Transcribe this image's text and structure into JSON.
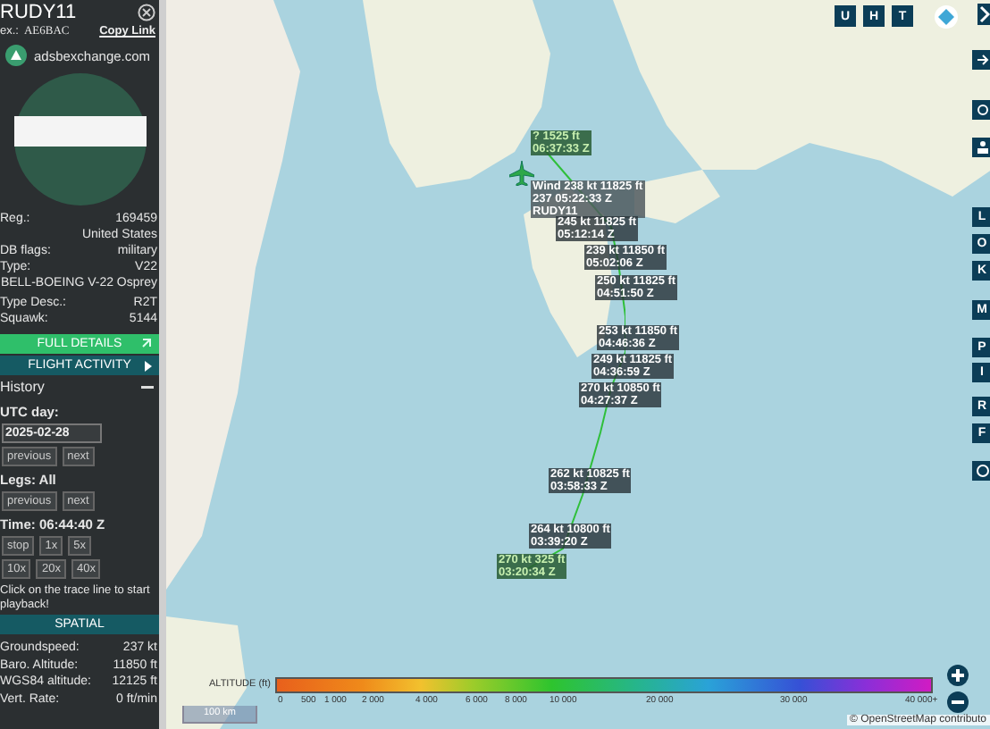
{
  "sidebar": {
    "title": "RUDY11",
    "hex_label": "ex.:",
    "hex": "AE6BAC",
    "copy_link": "Copy Link",
    "source": "adsbexchange.com",
    "details": [
      {
        "kind": "pair",
        "label": "Reg.:",
        "value": "169459"
      },
      {
        "kind": "value",
        "value": "United States"
      },
      {
        "kind": "pair",
        "label": "DB flags:",
        "value": "military"
      },
      {
        "kind": "pair",
        "label": "Type:",
        "value": "V22"
      },
      {
        "kind": "value",
        "value": "BELL-BOEING V-22 Osprey"
      },
      {
        "kind": "pair",
        "label": "Type Desc.:",
        "value": "R2T"
      },
      {
        "kind": "pair",
        "label": "Squawk:",
        "value": "5144"
      }
    ],
    "full_details": "FULL DETAILS",
    "flight_activity": {
      "label": "FLIGHT ACTIVITY",
      "expanded": false
    },
    "history": {
      "title": "History",
      "expanded": true,
      "utc_label": "UTC day:",
      "date": "2025-02-28",
      "day_buttons": [
        "previous",
        "next"
      ],
      "legs_label": "Legs: All",
      "leg_buttons": [
        "previous",
        "next"
      ],
      "time": "Time: 06:44:40 Z",
      "speed_buttons": [
        [
          "stop",
          "1x",
          "5x"
        ],
        [
          "10x",
          "20x",
          "40x"
        ]
      ],
      "hint": "Click on the trace line to start playback!"
    },
    "spatial": {
      "title": "SPATIAL",
      "rows": [
        {
          "label": "Groundspeed:",
          "value": "237 kt"
        },
        {
          "label": "Baro. Altitude:",
          "value": "11850 ft"
        },
        {
          "label": "WGS84 altitude:",
          "value": "12125 ft"
        },
        {
          "label": "Vert. Rate:",
          "value": "0 ft/min"
        }
      ]
    }
  },
  "map": {
    "top_buttons": [
      "U",
      "H",
      "T"
    ],
    "side_buttons": [
      "L",
      "O",
      "K",
      "M",
      "P",
      "I",
      "R",
      "F"
    ],
    "trace_labels": [
      {
        "kind": "endpoint",
        "lines": [
          "? 1525 ft",
          "06:37:33 Z"
        ]
      },
      {
        "kind": "hover",
        "lines": [
          "Wind 238 kt 11825 ft",
          "237 05:22:33 Z",
          "RUDY11"
        ]
      },
      {
        "kind": "point",
        "lines": [
          "245 kt 11825 ft",
          "05:12:14 Z"
        ]
      },
      {
        "kind": "point",
        "lines": [
          "239 kt 11850 ft",
          "05:02:06 Z"
        ]
      },
      {
        "kind": "point",
        "lines": [
          "250 kt 11825 ft",
          "04:51:50 Z"
        ]
      },
      {
        "kind": "point",
        "lines": [
          "253 kt 11850 ft",
          "04:46:36 Z"
        ]
      },
      {
        "kind": "point",
        "lines": [
          "249 kt 11825 ft",
          "04:36:59 Z"
        ]
      },
      {
        "kind": "point",
        "lines": [
          "270 kt 10850 ft",
          "04:27:37 Z"
        ]
      },
      {
        "kind": "point",
        "lines": [
          "262 kt 10825 ft",
          "03:58:33 Z"
        ]
      },
      {
        "kind": "point",
        "lines": [
          "264 kt 10800 ft",
          "03:39:20 Z"
        ]
      },
      {
        "kind": "endpoint",
        "lines": [
          "270 kt 325 ft",
          "03:20:34 Z"
        ]
      }
    ],
    "legend": {
      "title": "ALTITUDE (ft)",
      "ticks": [
        "0",
        "500",
        "1 000",
        "2 000",
        "4 000",
        "6 000",
        "8 000",
        "10 000",
        "20 000",
        "30 000",
        "40 000+"
      ]
    },
    "scale": "100 km",
    "attribution": "© OpenStreetMap contributo"
  }
}
